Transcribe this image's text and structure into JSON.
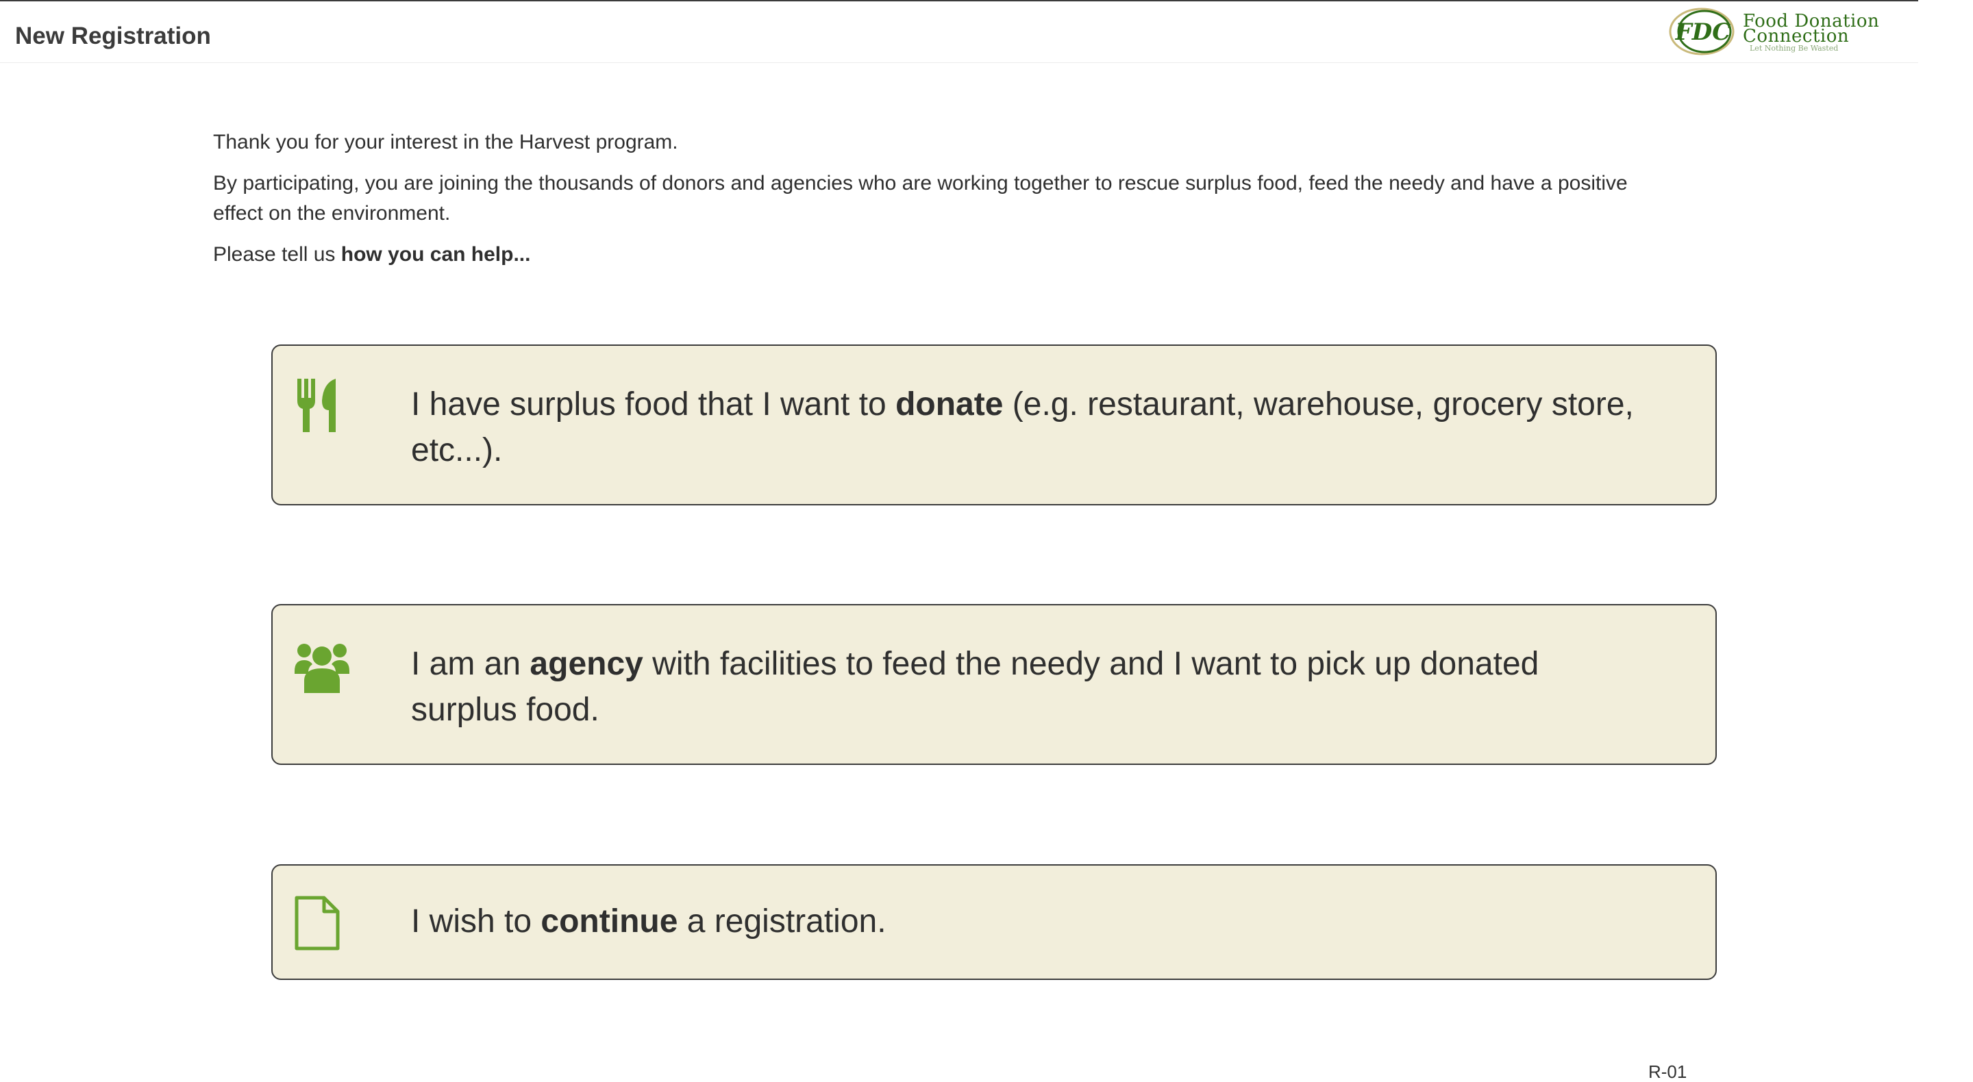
{
  "header": {
    "title": "New Registration",
    "logo": {
      "mark_text": "FDC",
      "line1": "Food Donation",
      "line2": "Connection",
      "tagline": "Let Nothing Be Wasted"
    }
  },
  "intro": {
    "line1": "Thank you for your interest in the Harvest program.",
    "line2": "By participating, you are joining the thousands of donors and agencies who are working together to rescue surplus food, feed the needy and have a positive effect on the environment.",
    "line3_prefix": "Please tell us ",
    "line3_bold": "how you can help..."
  },
  "options": [
    {
      "icon": "cutlery-icon",
      "text_before": "I have surplus food that I want to ",
      "text_bold": "donate",
      "text_after": " (e.g. restaurant, warehouse, grocery store, etc...)."
    },
    {
      "icon": "group-icon",
      "text_before": "I am an ",
      "text_bold": "agency",
      "text_after": " with facilities to feed the needy and I want to pick up donated surplus food."
    },
    {
      "icon": "document-icon",
      "text_before": "I wish to ",
      "text_bold": "continue",
      "text_after": " a registration."
    }
  ],
  "footer": {
    "page_code": "R-01"
  },
  "colors": {
    "accent_green": "#6aa530",
    "card_background": "#f2eedb",
    "logo_green": "#2f6e18"
  }
}
